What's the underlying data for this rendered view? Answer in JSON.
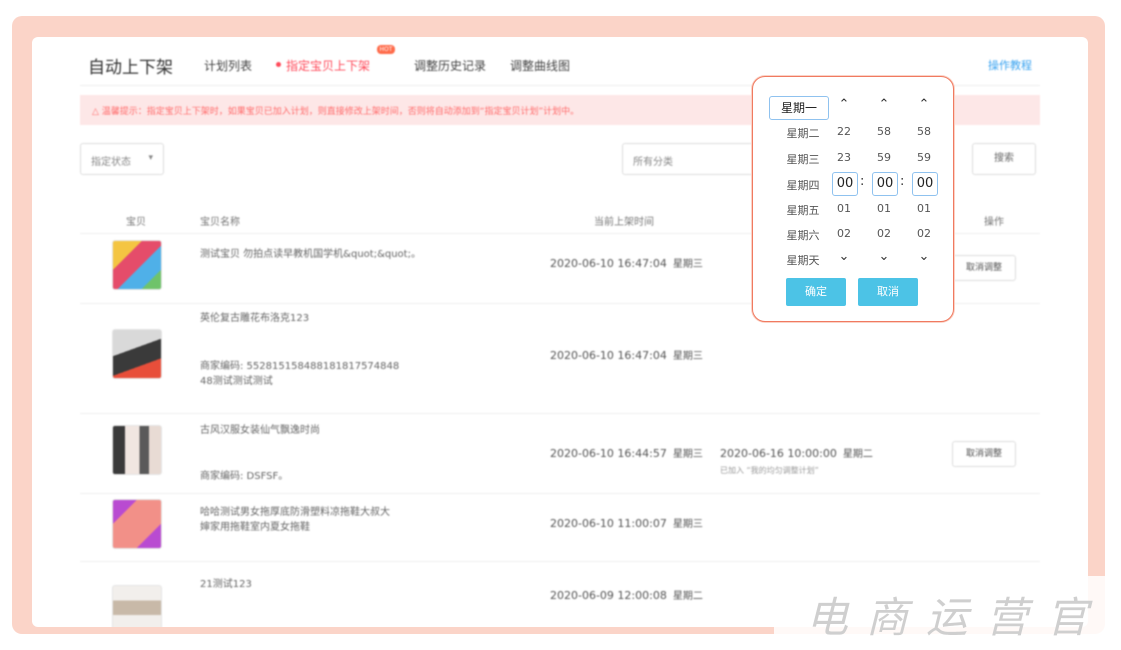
{
  "header": {
    "title": "自动上下架",
    "tabs": [
      "计划列表",
      "指定宝贝上下架",
      "调整历史记录",
      "调整曲线图"
    ],
    "active_tab_index": 1,
    "hot_badge": "HOT",
    "help_link": "操作教程"
  },
  "notice": "△ 温馨提示：指定宝贝上下架时，如果宝贝已加入计划，则直接修改上架时间，否则将自动添加到“指定宝贝计划”计划中。",
  "filters": {
    "status_select": "指定状态",
    "category_select": "所有分类",
    "search_button": "搜索"
  },
  "table": {
    "headers": {
      "item": "宝贝",
      "name": "宝贝名称",
      "current_time": "当前上架时间",
      "action": "操作"
    },
    "rows": [
      {
        "name": "测试宝贝 勿拍点读早教机国学机&quot;&quot;。",
        "time": "2020-06-10 16:47:04",
        "weekday": "星期三",
        "action": "取消调整"
      },
      {
        "name": "英伦复古雕花布洛克123",
        "code": "商家编码: 552815158488181817574848​48测试测试测试",
        "time": "2020-06-10 16:47:04",
        "weekday": "星期三"
      },
      {
        "name": "古风汉服女装仙气飘逸时尚",
        "code": "商家编码: DSFSF。",
        "time": "2020-06-10 16:44:57",
        "weekday": "星期三",
        "new_time": "2020-06-16 10:00:00",
        "new_weekday": "星期二",
        "note": "已加入 “我的均匀调整计划”",
        "action": "取消调整"
      },
      {
        "name": "哈哈测试男女拖厚底防滑塑料凉拖鞋大叔大婶家用拖鞋室内夏女拖鞋",
        "time": "2020-06-10 11:00:07",
        "weekday": "星期三"
      },
      {
        "name": "21测试123",
        "time": "2020-06-09 12:00:08",
        "weekday": "星期二"
      }
    ]
  },
  "picker": {
    "weekdays": [
      "星期一",
      "星期二",
      "星期三",
      "星期四",
      "星期五",
      "星期六",
      "星期天"
    ],
    "selected_weekday": "星期一",
    "hours": [
      "22",
      "23",
      "00",
      "01",
      "02"
    ],
    "minutes": [
      "58",
      "59",
      "00",
      "01",
      "02"
    ],
    "seconds": [
      "58",
      "59",
      "00",
      "01",
      "02"
    ],
    "hour": "00",
    "minute": "00",
    "second": "00",
    "confirm": "确定",
    "cancel": "取消"
  },
  "watermark": "电商运营官",
  "colors": {
    "accent": "#ff4a5a",
    "link": "#3aa3f0",
    "button": "#4cc3e6",
    "frame": "#fbd4c8",
    "picker_border": "#f07a60"
  }
}
